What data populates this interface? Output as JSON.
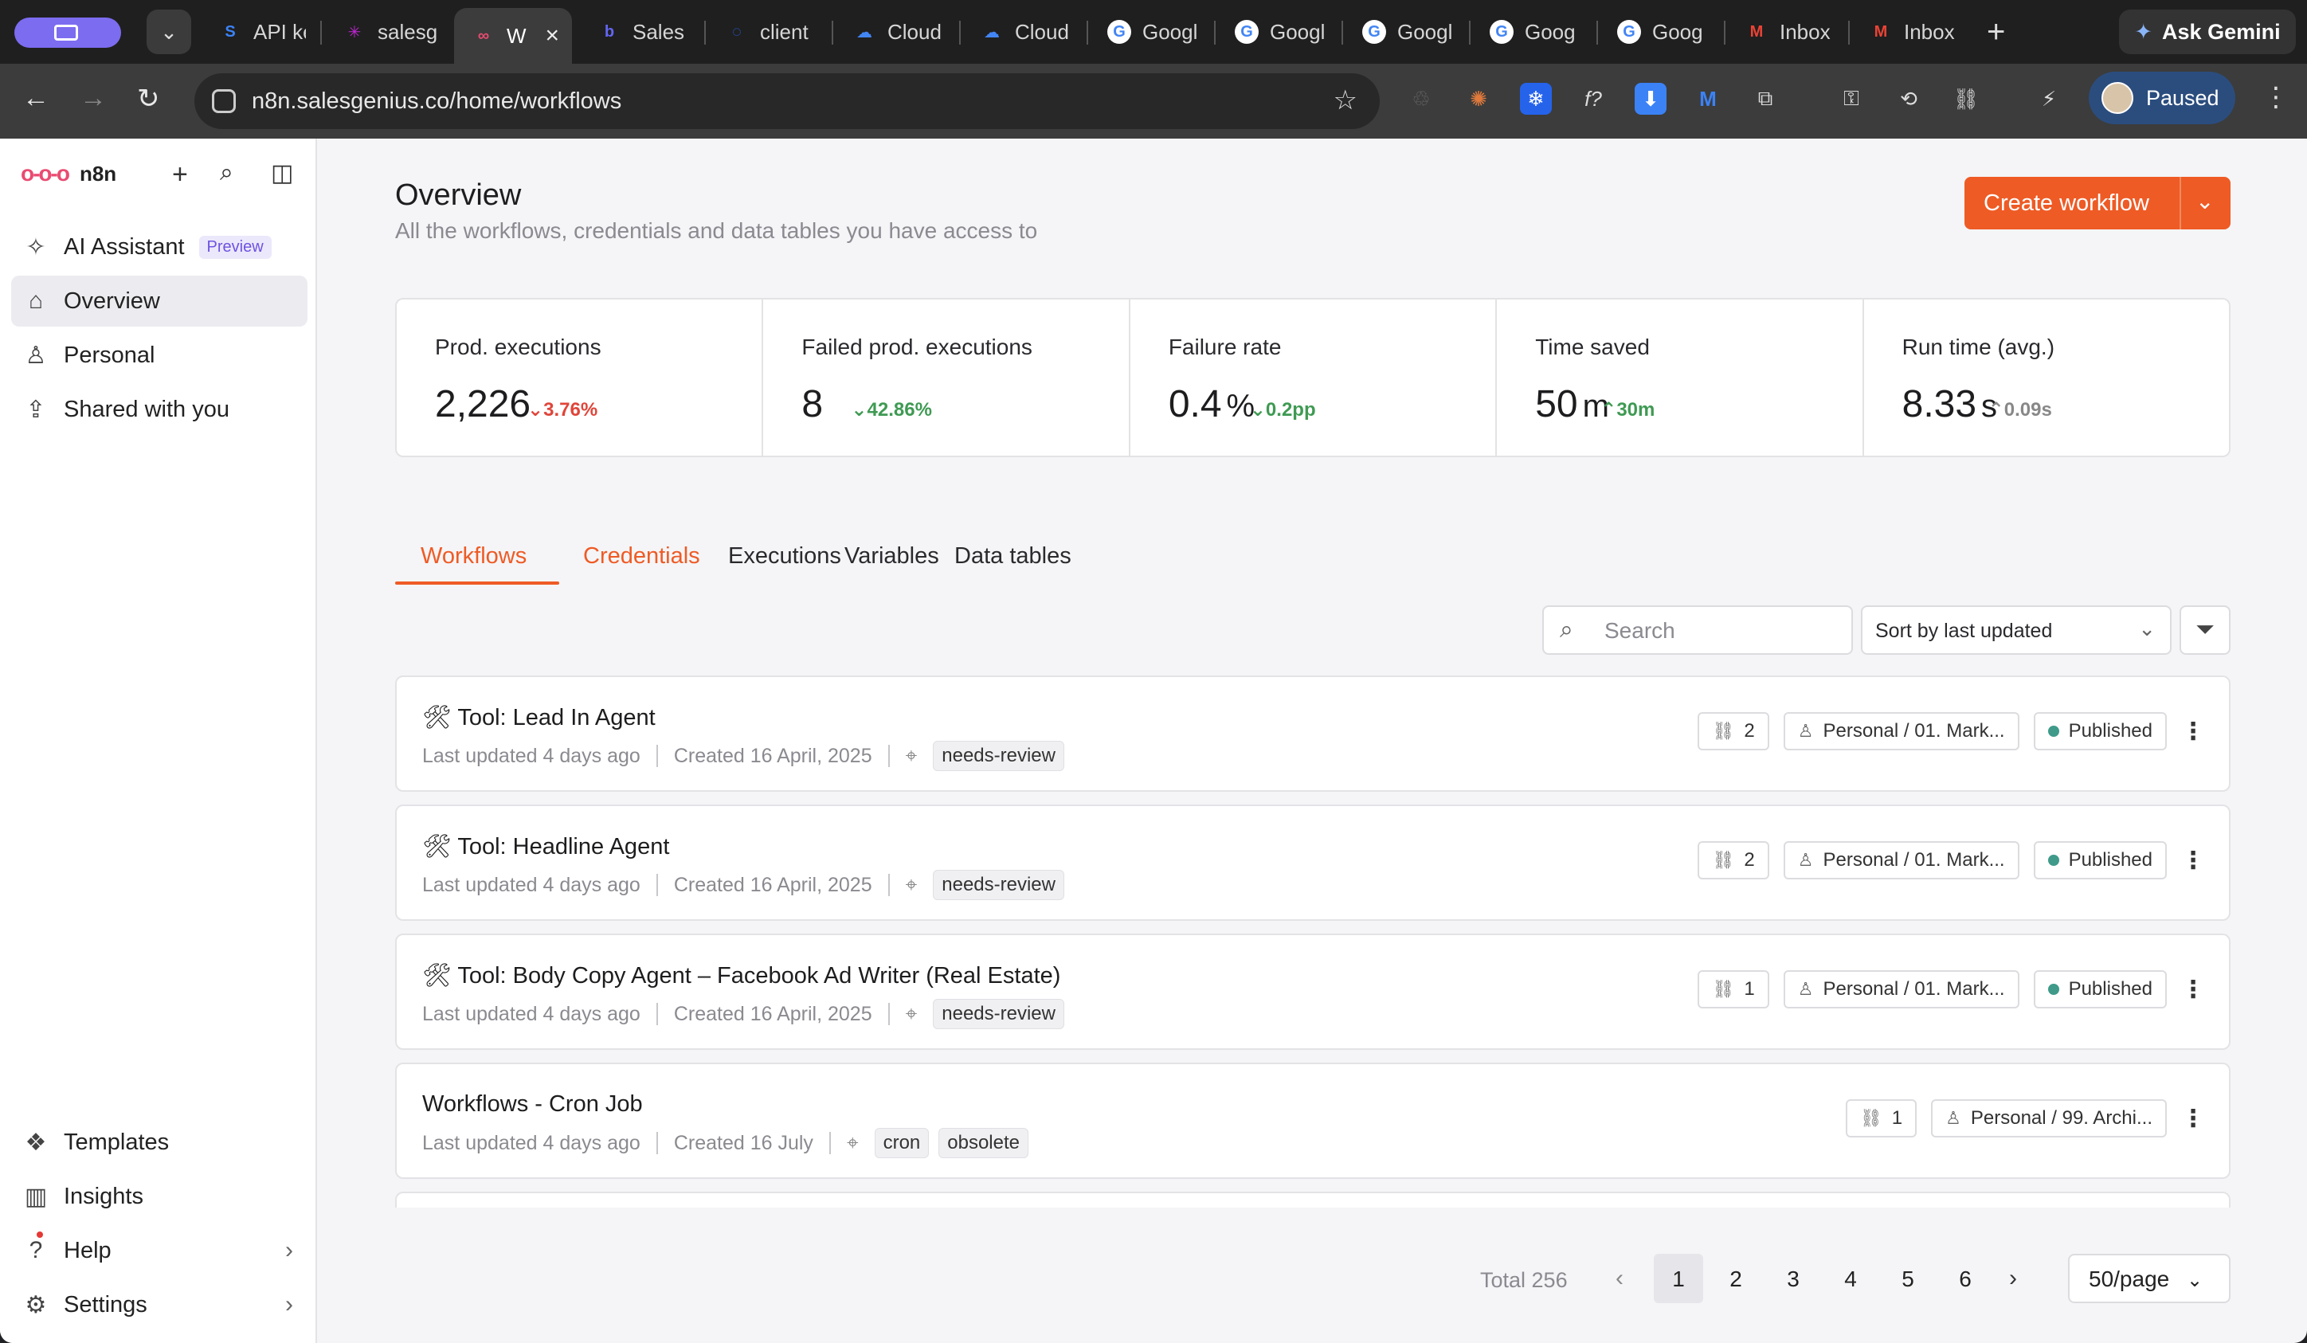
{
  "browser": {
    "tabs": [
      {
        "label": "API ke",
        "favicon_color": "#3b82f6"
      },
      {
        "label": "salesg",
        "favicon_color": "#c026d3"
      },
      {
        "label": "W",
        "favicon_color": "#ea4b71",
        "active": true
      },
      {
        "label": "Sales",
        "favicon_color": "#4f46e5"
      },
      {
        "label": "client",
        "favicon_color": "#2563eb"
      },
      {
        "label": "Cloud",
        "favicon_color": "#4285f4"
      },
      {
        "label": "Cloud",
        "favicon_color": "#4285f4"
      },
      {
        "label": "Googl",
        "favicon_color": "#ffffff"
      },
      {
        "label": "Googl",
        "favicon_color": "#ffffff"
      },
      {
        "label": "Googl",
        "favicon_color": "#ffffff"
      },
      {
        "label": "Goog",
        "favicon_color": "#ffffff"
      },
      {
        "label": "Goog",
        "favicon_color": "#ffffff"
      },
      {
        "label": "Inbox",
        "favicon_color": "#ea4335"
      },
      {
        "label": "Inbox",
        "favicon_color": "#ea4335"
      }
    ],
    "ask_gemini": "Ask Gemini",
    "url": "n8n.salesgenius.co/home/workflows",
    "profile_status": "Paused"
  },
  "sidebar": {
    "app_name": "n8n",
    "items_top": [
      {
        "label": "AI Assistant",
        "badge": "Preview"
      },
      {
        "label": "Overview"
      },
      {
        "label": "Personal"
      },
      {
        "label": "Shared with you"
      }
    ],
    "items_bottom": [
      {
        "label": "Templates"
      },
      {
        "label": "Insights"
      },
      {
        "label": "Help"
      },
      {
        "label": "Settings"
      }
    ]
  },
  "header": {
    "title": "Overview",
    "subtitle": "All the workflows, credentials and data tables you have access to",
    "create_button": "Create workflow"
  },
  "stats": [
    {
      "label": "Prod. executions",
      "value": "2,226",
      "delta": "3.76%",
      "trend": "down",
      "color": "#e0453a"
    },
    {
      "label": "Failed prod. executions",
      "value": "8",
      "delta": "42.86%",
      "trend": "down",
      "color": "#3f9a53"
    },
    {
      "label": "Failure rate",
      "value": "0.4",
      "unit": "%",
      "delta": "0.2pp",
      "trend": "down",
      "color": "#3f9a53"
    },
    {
      "label": "Time saved",
      "value": "50",
      "unit": "m",
      "delta": "30m",
      "trend": "up",
      "color": "#3f9a53"
    },
    {
      "label": "Run time (avg.)",
      "value": "8.33",
      "unit": "s",
      "delta": "0.09s",
      "trend": "up",
      "color": "#888888"
    }
  ],
  "tabs": [
    "Workflows",
    "Credentials",
    "Executions",
    "Variables",
    "Data tables"
  ],
  "filters": {
    "search_placeholder": "Search",
    "sort": "Sort by last updated"
  },
  "workflows": [
    {
      "title": "🛠 Tool: Lead In Agent",
      "updated": "Last updated 4 days ago",
      "created": "Created 16 April, 2025",
      "tags": [
        "needs-review"
      ],
      "links": "2",
      "project": "Personal / 01. Mark...",
      "status": "Published"
    },
    {
      "title": "🛠 Tool: Headline Agent",
      "updated": "Last updated 4 days ago",
      "created": "Created 16 April, 2025",
      "tags": [
        "needs-review"
      ],
      "links": "2",
      "project": "Personal / 01. Mark...",
      "status": "Published"
    },
    {
      "title": "🛠 Tool: Body Copy Agent – Facebook Ad Writer (Real Estate)",
      "updated": "Last updated 4 days ago",
      "created": "Created 16 April, 2025",
      "tags": [
        "needs-review"
      ],
      "links": "1",
      "project": "Personal / 01. Mark...",
      "status": "Published"
    },
    {
      "title": "Workflows - Cron Job",
      "updated": "Last updated 4 days ago",
      "created": "Created 16 July",
      "tags": [
        "cron",
        "obsolete"
      ],
      "links": "1",
      "project": "Personal / 99. Archi...",
      "status": ""
    }
  ],
  "pagination": {
    "total": "Total 256",
    "pages": [
      "1",
      "2",
      "3",
      "4",
      "5",
      "6"
    ],
    "current": "1",
    "per_page": "50/page"
  }
}
